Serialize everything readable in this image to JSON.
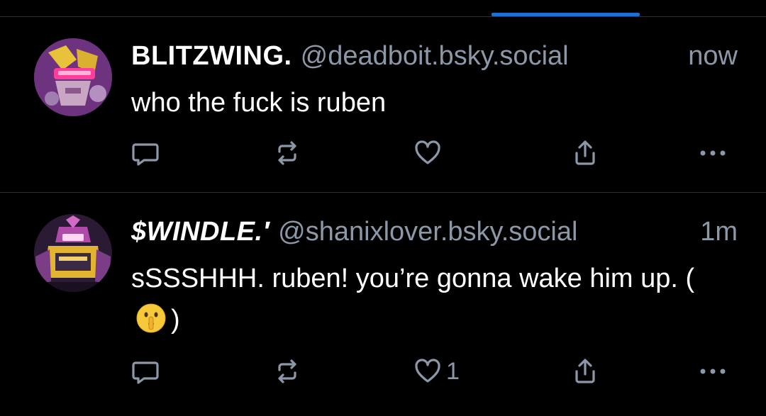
{
  "colors": {
    "background": "#000000",
    "text_primary": "#ffffff",
    "text_secondary": "#8c98a8",
    "divider": "#2a2e35",
    "tab_indicator": "#1f6fd1",
    "icon": "#8c98a8"
  },
  "posts": [
    {
      "display_name": "BLITZWING.",
      "handle": "@deadboit.bsky.social",
      "timestamp": "now",
      "text": "who the fuck is ruben",
      "avatar_icon": "robot-avatar-pink",
      "like_count": ""
    },
    {
      "display_name": "$WINDLE.′",
      "handle": "@shanixlover.bsky.social",
      "timestamp": "1m",
      "text_before_emoji": "sSSSHHH. ruben! you’re gonna wake him up. (",
      "emoji": "shushing-face-emoji",
      "text_after_emoji": ")",
      "avatar_icon": "robot-avatar-purple",
      "like_count": "1"
    }
  ],
  "action_icons": [
    "reply-icon",
    "repost-icon",
    "like-icon",
    "share-icon",
    "more-icon"
  ]
}
